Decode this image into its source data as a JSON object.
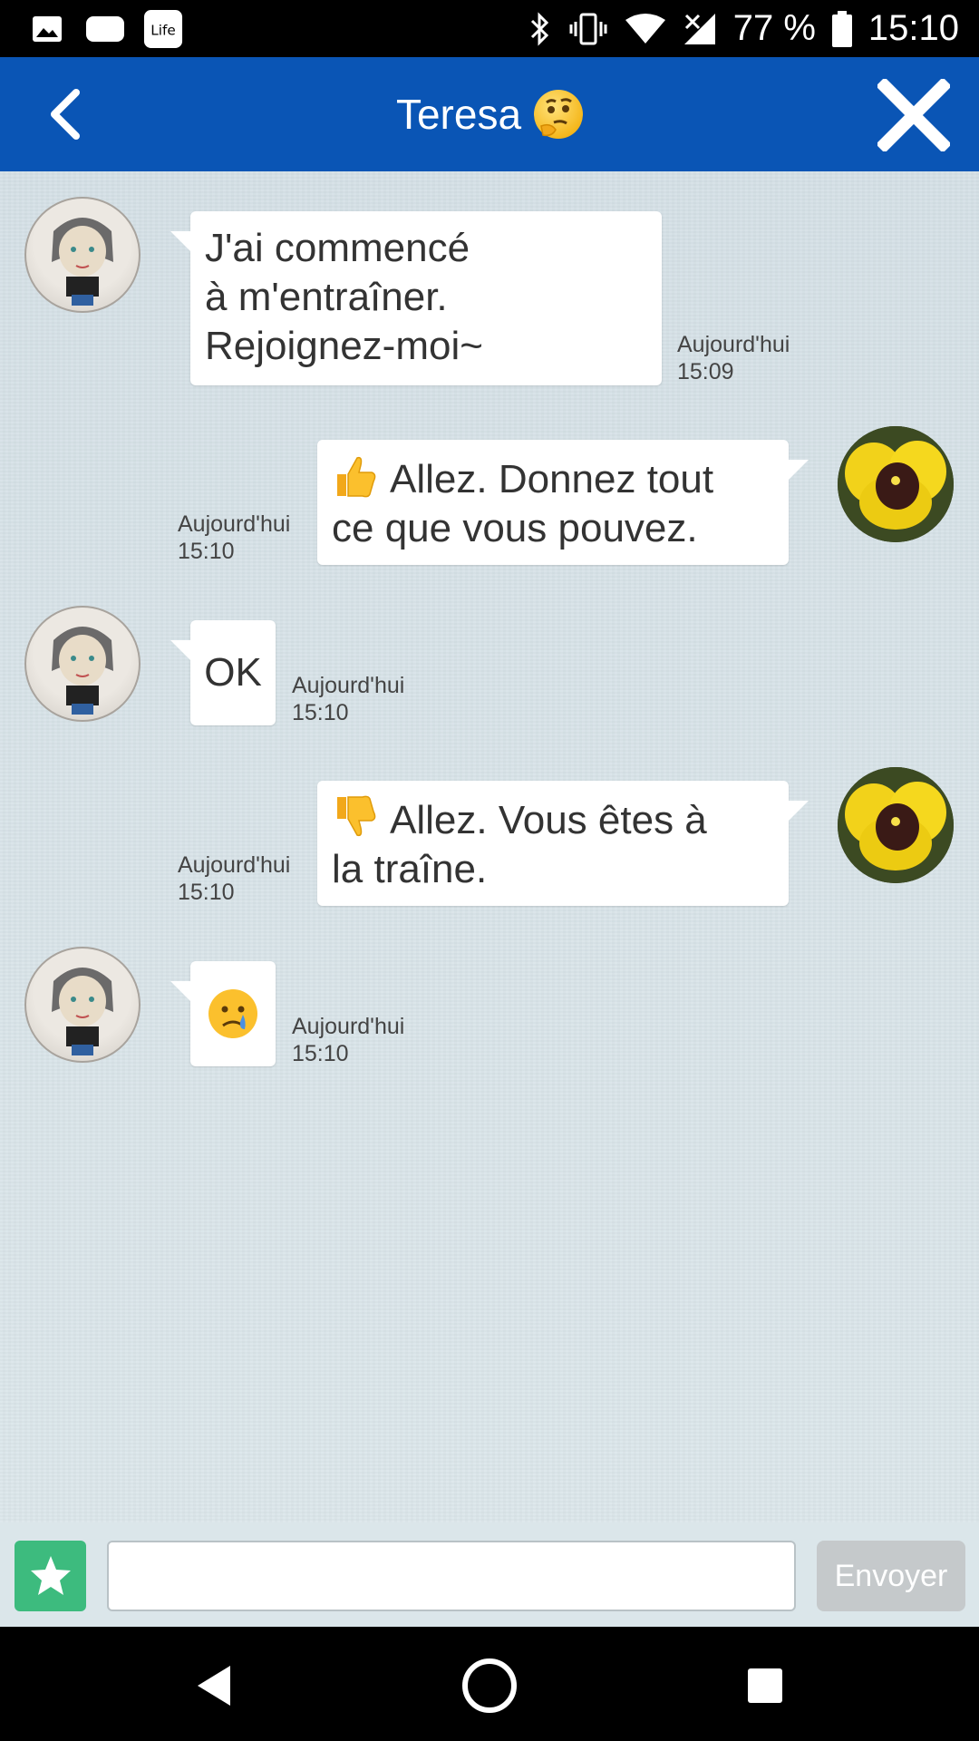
{
  "status_bar": {
    "battery": "77 %",
    "time": "15:10",
    "left_icons": [
      "image-icon",
      "cloud-icon",
      "lifesum-icon"
    ],
    "right_icons": [
      "bluetooth-icon",
      "vibrate-icon",
      "wifi-icon",
      "no-signal-icon",
      "battery-icon"
    ]
  },
  "header": {
    "title": "Teresa",
    "title_emoji": "thinking-face-emoji",
    "back_icon": "chevron-left-icon",
    "close_icon": "close-icon",
    "background_color": "#0a55b5"
  },
  "messages": [
    {
      "sender": "Teresa",
      "side": "left",
      "lines": [
        "J'ai commencé",
        "à m'entraîner.",
        "Rejoignez-moi~"
      ],
      "timestamp_day": "Aujourd'hui",
      "timestamp_time": "15:09"
    },
    {
      "sender": "me",
      "side": "right",
      "emoji": "thumbs-up-emoji",
      "lines": [
        "Allez. Donnez tout",
        "ce que vous pouvez."
      ],
      "timestamp_day": "Aujourd'hui",
      "timestamp_time": "15:10"
    },
    {
      "sender": "Teresa",
      "side": "left",
      "lines": [
        "OK"
      ],
      "timestamp_day": "Aujourd'hui",
      "timestamp_time": "15:10"
    },
    {
      "sender": "me",
      "side": "right",
      "emoji": "thumbs-down-emoji",
      "lines": [
        "Allez. Vous êtes à",
        "la traîne."
      ],
      "timestamp_day": "Aujourd'hui",
      "timestamp_time": "15:10"
    },
    {
      "sender": "Teresa",
      "side": "left",
      "emoji": "crying-face-emoji",
      "lines": [],
      "timestamp_day": "Aujourd'hui",
      "timestamp_time": "15:10"
    }
  ],
  "composer": {
    "input_value": "",
    "send_label": "Envoyer",
    "favorite_icon": "star-icon",
    "favorite_color": "#3dbb7e"
  },
  "nav_bar": {
    "icons": [
      "back-triangle-icon",
      "home-circle-icon",
      "recents-square-icon"
    ]
  }
}
